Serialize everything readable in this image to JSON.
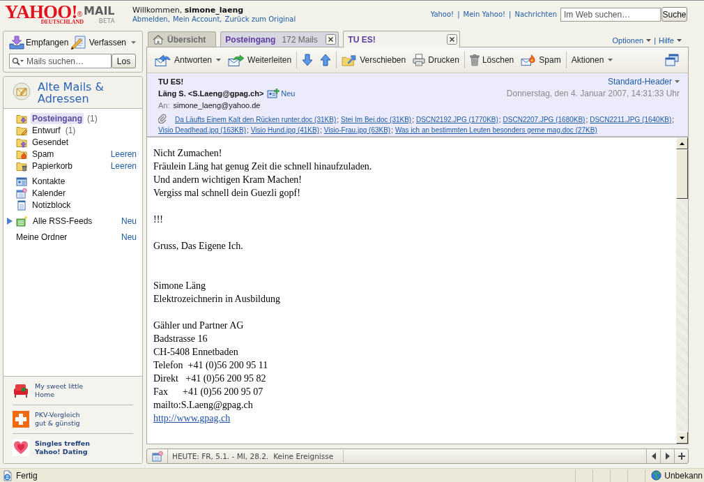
{
  "header": {
    "logo": {
      "brand": "YAHOO!",
      "mark": "®",
      "region": "DEUTSCHLAND",
      "product": "MAIL",
      "edition": "BETA"
    },
    "welcome": "Willkommen, **simone_laeng**",
    "account_links": {
      "items": [
        "Abmelden",
        "Mein Account",
        "Zurück zum Original"
      ],
      "separator": ","
    },
    "top_links": {
      "items": [
        "Yahoo!",
        "Mein Yahoo!",
        "Nachrichten"
      ],
      "separator": "|"
    },
    "web_search": {
      "placeholder": "Im Web suchen…",
      "button": "Suche"
    }
  },
  "sidebar": {
    "receive": {
      "label": "Empfangen"
    },
    "compose": {
      "label": "Verfassen",
      "menu": true
    },
    "mail_search": {
      "placeholder": "Mails suchen…",
      "button": "Los"
    },
    "banner": "Alte Mails & Adressen",
    "folders": [
      {
        "kind": "inbox",
        "label": "Posteingang",
        "count": "(1)",
        "selected": true
      },
      {
        "kind": "drafts",
        "label": "Entwurf",
        "count": "(1)",
        "selected": false
      },
      {
        "kind": "sent",
        "label": "Gesendet",
        "selected": false
      },
      {
        "kind": "spam",
        "label": "Spam",
        "action": "Leeren",
        "selected": false
      },
      {
        "kind": "trash",
        "label": "Papierkorb",
        "action": "Leeren",
        "selected": false
      }
    ],
    "tools": [
      {
        "kind": "contacts",
        "label": "Kontakte"
      },
      {
        "kind": "calendar",
        "label": "Kalender"
      },
      {
        "kind": "notepad",
        "label": "Notizblock"
      }
    ],
    "feeds": {
      "label": "Alle RSS-Feeds",
      "action": "Neu",
      "expanded": false
    },
    "my_folders": {
      "label": "Meine Ordner",
      "action": "Neu"
    },
    "ads": [
      {
        "kind": "chair",
        "lines": [
          "My sweet little",
          "Home"
        ],
        "bold": false
      },
      {
        "kind": "cross",
        "lines": [
          "PKV-Vergleich",
          "gut & günstig"
        ],
        "bold": false
      },
      {
        "kind": "heart",
        "lines": [
          "Singles treffen",
          "Yahoo! Dating"
        ],
        "bold": true
      }
    ]
  },
  "tabs": [
    {
      "kind": "home",
      "label": "Übersicht",
      "closable": false,
      "selected": false
    },
    {
      "kind": "folder",
      "label": "Posteingang",
      "count": "172 Mails",
      "closable": true,
      "selected": false
    },
    {
      "kind": "message",
      "label": "TU ES!",
      "closable": true,
      "selected": true
    }
  ],
  "tab_menus": {
    "items": [
      "Optionen",
      "Hilfe"
    ],
    "separator": "|"
  },
  "toolbar": {
    "groups": [
      [
        {
          "kind": "reply",
          "label": "Antworten",
          "menu": true
        },
        {
          "kind": "forward",
          "label": "Weiterleiten",
          "menu": false
        }
      ],
      [
        {
          "kind": "down",
          "menu": false
        },
        {
          "kind": "up",
          "menu": false
        }
      ],
      [
        {
          "kind": "move",
          "label": "Verschieben",
          "menu": false
        },
        {
          "kind": "print",
          "label": "Drucken",
          "menu": false
        }
      ],
      [
        {
          "kind": "delete",
          "label": "Löschen",
          "menu": false
        },
        {
          "kind": "spam",
          "label": "Spam",
          "menu": false
        }
      ],
      [
        {
          "kind": "actions",
          "label": "Aktionen",
          "menu": true
        }
      ]
    ]
  },
  "message": {
    "subject": "TU ES!",
    "header_view": "Standard-Header",
    "from": "Läng S. <S.Laeng@gpag.ch>",
    "add_contact": "Neu",
    "date": "Donnerstag, den 4. Januar 2007, 14:31:33 Uhr",
    "to_label": "An:",
    "to": "simone_laeng@yahoo.de",
    "attachments": [
      "Da Läufts Einem Kalt den Rücken runter.doc (31KB)",
      "Stei Im Bei.doc (31KB)",
      "DSCN2192.JPG (1770KB)",
      "DSCN2207.JPG (1680KB)",
      "DSCN2211.JPG (1640KB)",
      "Visio Deadhead.jpg (163KB)",
      "Visio Hund.jpg (41KB)",
      "Visio-Frau.jpg (63KB)",
      "Was ich an bestimmten Leuten besonders gerne mag.doc (27KB)"
    ],
    "attachment_separator": ";",
    "body": [
      [
        "Nicht Zumachen!",
        "Fräulein Läng hat genug Zeit die schnell hinaufzuladen.",
        "Und andern wichtigen Kram Machen!",
        "Vergiss mal schnell dein Guezli gopf!"
      ],
      [
        "!!!"
      ],
      [
        "Gruss, Das Eigene Ich."
      ]
    ],
    "signature": [
      [
        {
          "kind": "text",
          "text": "Simone Läng"
        },
        {
          "kind": "text",
          "text": "Elektrozeichnerin in Ausbildung"
        }
      ],
      [
        {
          "kind": "text",
          "text": "Gähler und Partner AG"
        },
        {
          "kind": "text",
          "text": "Badstrasse 16"
        },
        {
          "kind": "text",
          "text": "CH-5408 Ennetbaden"
        },
        {
          "kind": "text",
          "text": "Telefon  +41 (0)56 200 95 11"
        },
        {
          "kind": "text",
          "text": "Direkt   +41 (0)56 200 95 82"
        },
        {
          "kind": "text",
          "text": "Fax      +41 (0)56 200 95 07"
        },
        {
          "kind": "text",
          "text": "mailto:S.Laeng@gpag.ch"
        },
        {
          "kind": "link",
          "text": "http://www.gpag.ch"
        }
      ]
    ]
  },
  "calendar_bar": {
    "range": "HEUTE: FR, 5.1. - MI, 28.2.",
    "events": "Keine Ereignisse"
  },
  "status_bar": {
    "text": "Fertig",
    "zone": "Unbekann"
  }
}
